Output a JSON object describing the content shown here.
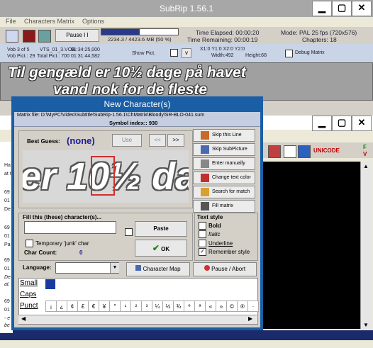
{
  "main_window": {
    "title": "SubRip 1.56.1",
    "menu": [
      "File",
      "Characters Matrix",
      "Options"
    ],
    "toolbar": {
      "pause_label": "Pause I I",
      "progress_fraction": 0.5,
      "progress_text": "2234.3 / 4423.6 MB (50 %)",
      "time_elapsed": "Time Elapsed: 00:00:20",
      "time_remaining": "Time Remaining: 00:00:19",
      "mode": "Mode: PAL 25 fps (720x576)",
      "chapters": "Chapters: 18"
    },
    "info": {
      "vob": "Vob 3  of  5",
      "vob_file": "VTS_01_3.VOB",
      "vob_time": "01:34:25,000",
      "vob_pict": "Vob Pict.:  29",
      "total_pict": "Total Pict.:  700",
      "total_time": "01:31:44,582",
      "show_pict": "Show Pict.",
      "coords": "X1:0   Y1:0   X2:0   Y2:0",
      "width": "Width:492",
      "height": "Height:68",
      "debug_matrix": "Debug Matrix"
    },
    "subtitle_lines": [
      "Til gengæld er 10½ dage på havet",
      "vand nok for de fleste"
    ]
  },
  "second_window": {
    "unicode_label": "UNICODE",
    "left_log": [
      "Ha",
      "at t",
      "69",
      "01",
      "De",
      "69",
      "01",
      "Pa",
      "69",
      "01",
      "De",
      "at.",
      "69",
      "01",
      "- e",
      "be"
    ],
    "right_labels": [
      "F",
      "V"
    ]
  },
  "dialog": {
    "title": "New Character(s)",
    "matrix_file": "Matrix file: D:\\MyPC\\Video\\Subtitle\\SubRip-1.56.1\\ChMatrix\\Bloody\\SR-BLO-041.sum",
    "symbol_index": "Symbol index:: 930",
    "best_guess_label": "Best Guess:",
    "best_guess_value": "(none)",
    "use_label": "Use",
    "prev_label": "<<",
    "next_label": ">>",
    "glyph_text": "er 10½ dag",
    "buttons": {
      "skip_line": "Skip this Line",
      "skip_subpicture": "Skip SubPicture",
      "enter_manually": "Enter manually",
      "change_text_color": "Change text color",
      "search_for_match": "Search for match",
      "fill_matrix": "Fill matrix"
    },
    "fill_label": "Fill this (these) character(s)...",
    "fill_value": "",
    "paste_label": "Paste",
    "ok_label": "OK",
    "temporary_junk": "Temporary 'junk' char",
    "char_count_label": "Char Count:",
    "char_count_value": "0",
    "text_style": {
      "group_label": "Text style",
      "bold": "Bold",
      "italic": "Italic",
      "underline": "Underline",
      "remember": "Remember style",
      "remember_checked": true
    },
    "language_label": "Language:",
    "character_map_label": "Character Map",
    "pause_abort_label": "Pause / Abort",
    "tabs": [
      "Small",
      "Caps",
      "Punct"
    ],
    "punct_chars": [
      "¡",
      "¿",
      "¢",
      "£",
      "€",
      "¥",
      "°",
      "¹",
      "²",
      "³",
      "¼",
      "½",
      "¾",
      "º",
      "ª",
      "«",
      "»",
      "©",
      "®",
      "·"
    ]
  }
}
